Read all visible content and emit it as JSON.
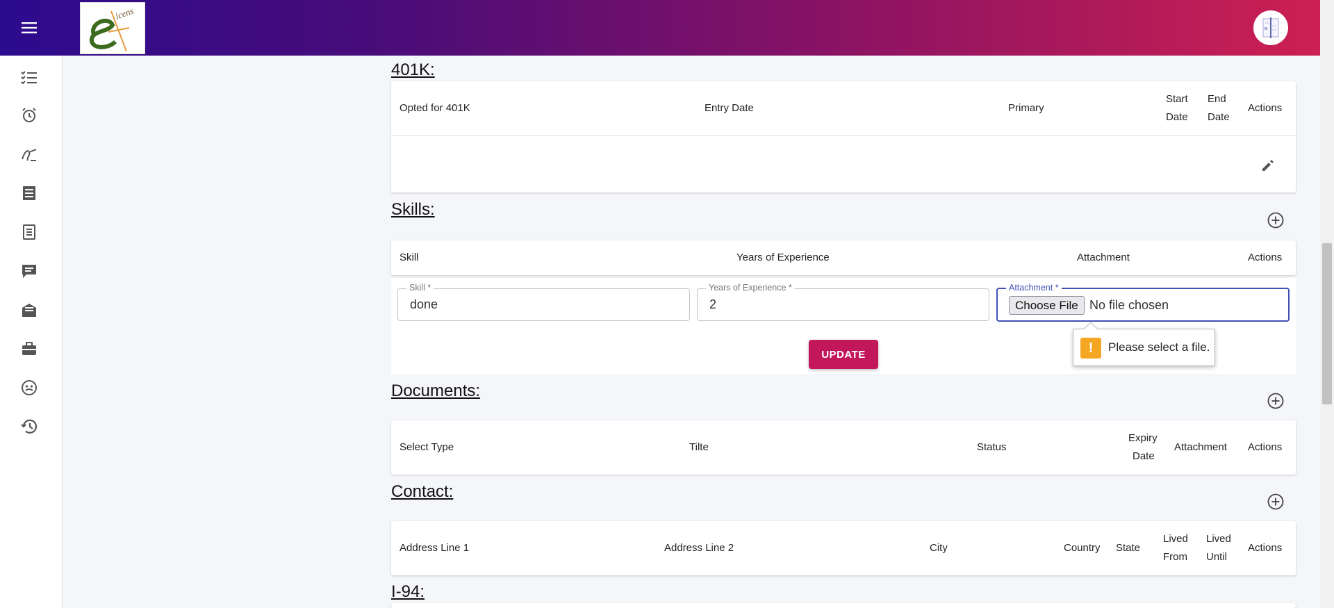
{
  "sections": {
    "k401": {
      "title": "401K:",
      "columns": [
        "Opted for 401K",
        "Entry Date",
        "Primary",
        "Start",
        "Date",
        "End",
        "Date",
        "Actions"
      ]
    },
    "skills": {
      "title": "Skills:",
      "columns": [
        "Skill",
        "Years of Experience",
        "Attachment",
        "Actions"
      ],
      "form": {
        "skill_label": "Skill *",
        "skill_value": "done",
        "years_label": "Years of Experience *",
        "years_value": "2",
        "attachment_label": "Attachment *",
        "choose_file": "Choose File",
        "file_status": "No file chosen",
        "update_label": "UPDATE",
        "validation_message": "Please select a file.",
        "validation_icon": "!"
      }
    },
    "documents": {
      "title": "Documents:",
      "columns": [
        "Select Type",
        "Tilte",
        "Status",
        "Expiry",
        "Date",
        "Attachment",
        "Actions"
      ]
    },
    "contact": {
      "title": "Contact:",
      "columns": [
        "Address Line 1",
        "Address Line 2",
        "City",
        "Country",
        "State",
        "Lived",
        "From",
        "Lived",
        "Until",
        "Actions"
      ]
    },
    "i94": {
      "title": "I-94:"
    }
  },
  "sidebar": {
    "icons": [
      "checklist-icon",
      "alarm-clock-icon",
      "signature-icon",
      "receipt-icon",
      "document-icon",
      "chat-icon",
      "mail-inbox-icon",
      "briefcase-icon",
      "face-icon",
      "history-icon"
    ]
  },
  "colors": {
    "header_gradient_start": "#2c0b8e",
    "header_gradient_end": "#cc2052",
    "primary_button": "#c2185b",
    "focus_border": "#3f51b5",
    "warning": "#f5a623"
  }
}
